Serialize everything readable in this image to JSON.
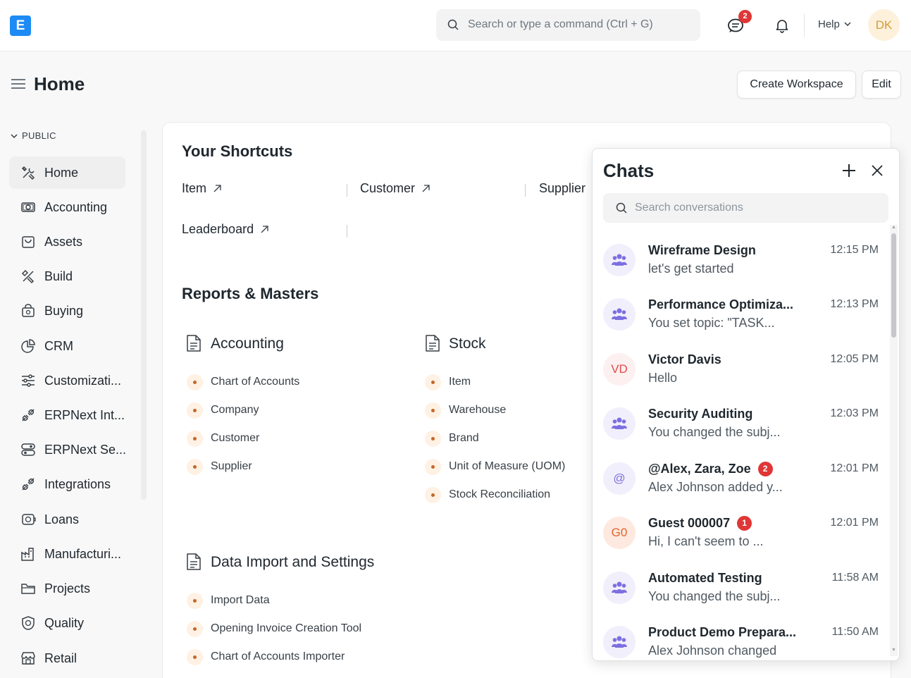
{
  "navbar": {
    "logo_letter": "E",
    "search_placeholder": "Search or type a command (Ctrl + G)",
    "chat_badge": "2",
    "help_label": "Help",
    "user_initials": "DK"
  },
  "page": {
    "title": "Home",
    "create_workspace_label": "Create Workspace",
    "edit_label": "Edit"
  },
  "sidebar": {
    "section": "PUBLIC",
    "items": [
      {
        "label": "Home",
        "icon": "tools-icon"
      },
      {
        "label": "Accounting",
        "icon": "money-icon"
      },
      {
        "label": "Assets",
        "icon": "bag-icon"
      },
      {
        "label": "Build",
        "icon": "build-icon"
      },
      {
        "label": "Buying",
        "icon": "buying-icon"
      },
      {
        "label": "CRM",
        "icon": "crm-icon"
      },
      {
        "label": "Customizati...",
        "icon": "sliders-icon"
      },
      {
        "label": "ERPNext Int...",
        "icon": "integration-icon"
      },
      {
        "label": "ERPNext Se...",
        "icon": "settings-icon"
      },
      {
        "label": "Integrations",
        "icon": "integration-icon"
      },
      {
        "label": "Loans",
        "icon": "loan-icon"
      },
      {
        "label": "Manufacturi...",
        "icon": "factory-icon"
      },
      {
        "label": "Projects",
        "icon": "folder-icon"
      },
      {
        "label": "Quality",
        "icon": "quality-icon"
      },
      {
        "label": "Retail",
        "icon": "store-icon"
      }
    ]
  },
  "shortcuts": {
    "title": "Your Shortcuts",
    "items": [
      "Item",
      "Customer",
      "Supplier",
      "Leaderboard"
    ]
  },
  "reports": {
    "title": "Reports & Masters",
    "accounting": {
      "title": "Accounting",
      "links": [
        "Chart of Accounts",
        "Company",
        "Customer",
        "Supplier"
      ]
    },
    "stock": {
      "title": "Stock",
      "links": [
        "Item",
        "Warehouse",
        "Brand",
        "Unit of Measure (UOM)",
        "Stock Reconciliation"
      ]
    },
    "data_import": {
      "title": "Data Import and Settings",
      "links": [
        "Import Data",
        "Opening Invoice Creation Tool",
        "Chart of Accounts Importer"
      ]
    }
  },
  "chat": {
    "title": "Chats",
    "search_placeholder": "Search conversations",
    "conversations": [
      {
        "name": "Wireframe Design",
        "preview": "let's get started",
        "time": "12:15 PM",
        "avatar": "group",
        "badge": ""
      },
      {
        "name": "Performance Optimiza...",
        "preview": "You set topic: \"TASK...",
        "time": "12:13 PM",
        "avatar": "group",
        "badge": ""
      },
      {
        "name": "Victor Davis",
        "preview": "Hello",
        "time": "12:05 PM",
        "avatar": "VD",
        "badge": ""
      },
      {
        "name": "Security Auditing",
        "preview": "You changed the subj...",
        "time": "12:03 PM",
        "avatar": "group",
        "badge": ""
      },
      {
        "name": "@Alex, Zara, Zoe",
        "preview": "Alex Johnson added y...",
        "time": "12:01 PM",
        "avatar": "@",
        "badge": "2"
      },
      {
        "name": "Guest 000007",
        "preview": "Hi, I can't seem to ...",
        "time": "12:01 PM",
        "avatar": "G0",
        "badge": "1"
      },
      {
        "name": "Automated Testing",
        "preview": "You changed the subj...",
        "time": "11:58 AM",
        "avatar": "group",
        "badge": ""
      },
      {
        "name": "Product Demo Prepara...",
        "preview": "Alex Johnson changed",
        "time": "11:50 AM",
        "avatar": "group",
        "badge": ""
      }
    ]
  },
  "colors": {
    "brand": "#1d8bf4",
    "badge": "#e03636",
    "link_dot": "#c2682a"
  }
}
